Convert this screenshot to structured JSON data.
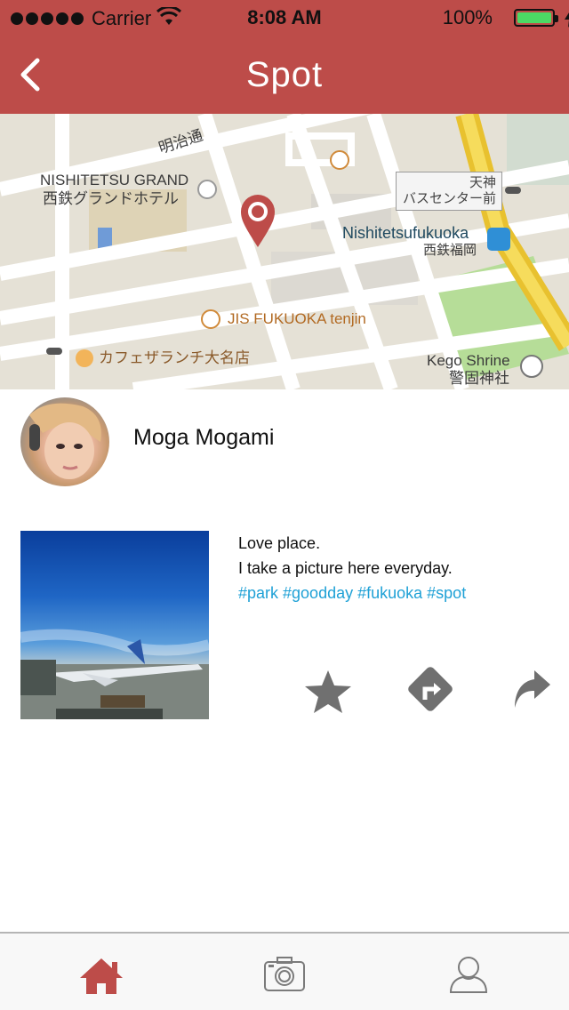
{
  "status_bar": {
    "carrier": "Carrier",
    "time": "8:08 AM",
    "battery": "100%"
  },
  "nav": {
    "title": "Spot"
  },
  "map": {
    "labels": {
      "hotel_en": "NISHITETSU GRAND",
      "hotel_jp": "西鉄グランドホテル",
      "road": "明治通",
      "bus_line1": "天神",
      "bus_line2": "バスセンター前",
      "station_en": "Nishitetsufukuoka",
      "station_jp": "西鉄福岡",
      "restaurant": "JIS FUKUOKA tenjin",
      "cafe": "カフェザランチ大名店",
      "shrine_en": "Kego Shrine",
      "shrine_jp": "警固神社"
    }
  },
  "profile": {
    "name": "Moga Mogami"
  },
  "post": {
    "line1": "Love place.",
    "line2": "I take a picture here everyday.",
    "tags": "#park #goodday #fukuoka #spot"
  },
  "colors": {
    "brand": "#bd4c49",
    "tag": "#1fa1d6",
    "icon": "#707070"
  },
  "tabs": [
    {
      "icon": "home-icon",
      "active": true
    },
    {
      "icon": "camera-icon",
      "active": false
    },
    {
      "icon": "user-icon",
      "active": false
    }
  ]
}
